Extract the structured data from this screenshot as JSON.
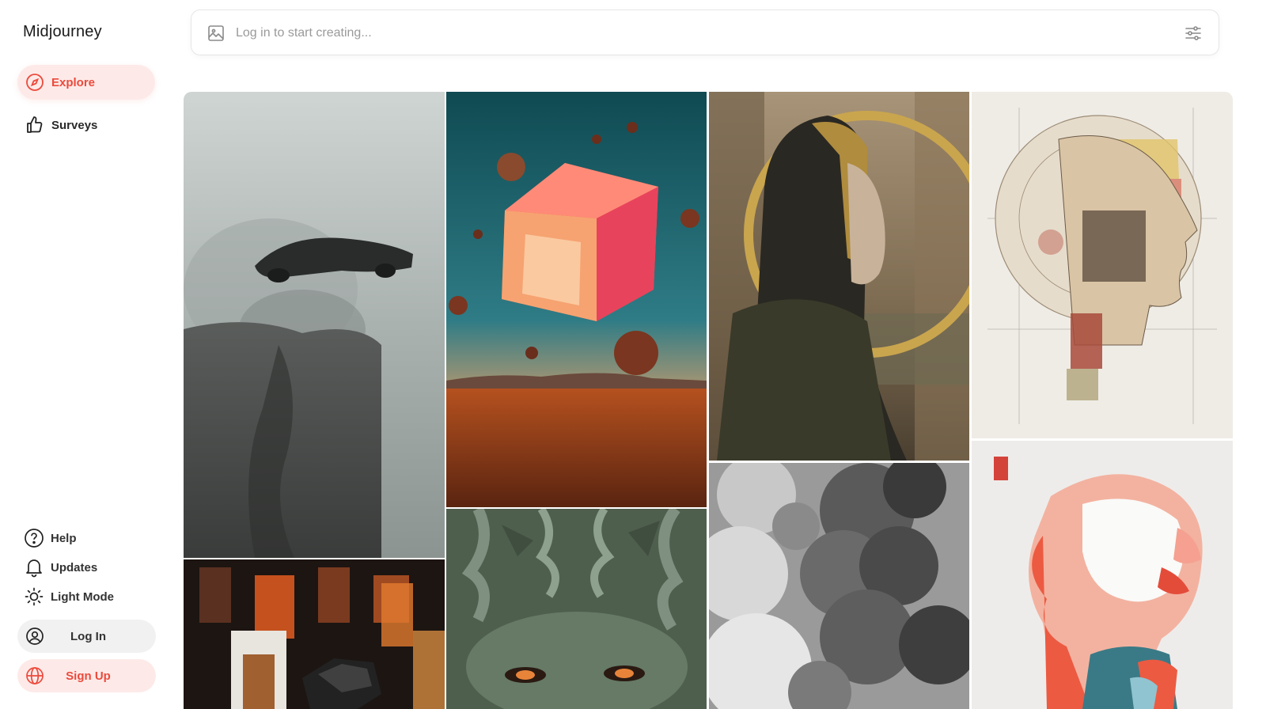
{
  "app": {
    "brand": "Midjourney"
  },
  "nav": {
    "explore": "Explore",
    "surveys": "Surveys"
  },
  "footer": {
    "help": "Help",
    "updates": "Updates",
    "light_mode": "Light Mode",
    "login": "Log In",
    "signup": "Sign Up"
  },
  "search": {
    "placeholder": "Log in to start creating..."
  },
  "colors": {
    "accent": "#ec4a3c",
    "accent_bg": "#fdeae8"
  },
  "icons": {
    "explore": "compass-icon",
    "surveys": "thumbs-up-icon",
    "help": "question-circle-icon",
    "updates": "bell-icon",
    "light_mode": "sun-icon",
    "login": "user-circle-icon",
    "signup": "globe-icon",
    "search_image": "image-icon",
    "filters": "sliders-icon"
  },
  "gallery": [
    {
      "subject": "car-over-cliff"
    },
    {
      "subject": "crystal-cube-desert"
    },
    {
      "subject": "gold-hooded-woman"
    },
    {
      "subject": "anatomical-head-diagram"
    },
    {
      "subject": "perfume-bottles"
    },
    {
      "subject": "green-carved-face"
    },
    {
      "subject": "smoke-clouds"
    },
    {
      "subject": "coral-lion"
    }
  ]
}
